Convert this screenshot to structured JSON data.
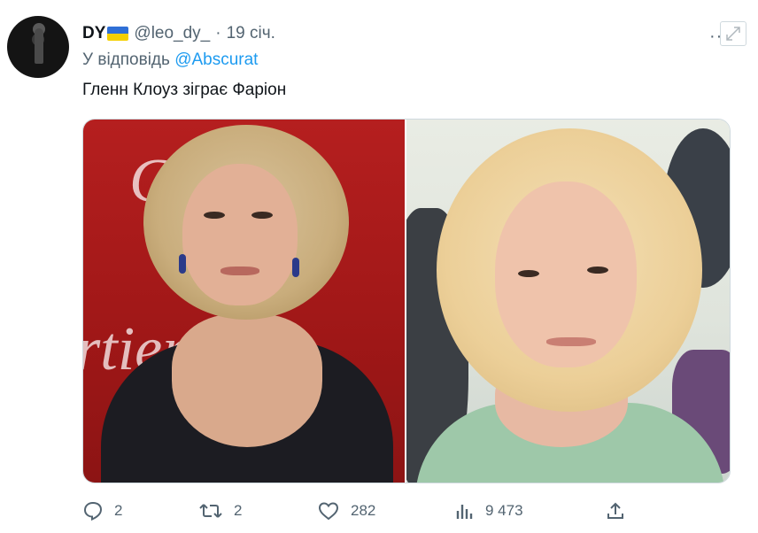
{
  "tweet": {
    "author_name": "DY",
    "flag": "ukraine-flag",
    "handle": "@leo_dy_",
    "separator": "·",
    "time": "19 січ.",
    "reply_prefix": "У відповідь",
    "reply_to": "@Abscurat",
    "text": "Гленн Клоуз зіграє Фаріон",
    "more_label": "··"
  },
  "media": {
    "left_watermark_top": "Cartier",
    "left_watermark_bottom": "rtier"
  },
  "actions": {
    "replies": "2",
    "retweets": "2",
    "likes": "282",
    "views": "9 473"
  },
  "colors": {
    "link": "#1d9bf0",
    "secondary_text": "#536471",
    "primary_text": "#0f1419",
    "left_photo_bg": "#b51f1f",
    "flag_blue": "#2f6fd6",
    "flag_yellow": "#f5d000"
  },
  "icons": {
    "reply": "reply-icon",
    "retweet": "retweet-icon",
    "like": "heart-icon",
    "views": "views-icon",
    "share": "share-icon",
    "expand": "expand-icon"
  }
}
